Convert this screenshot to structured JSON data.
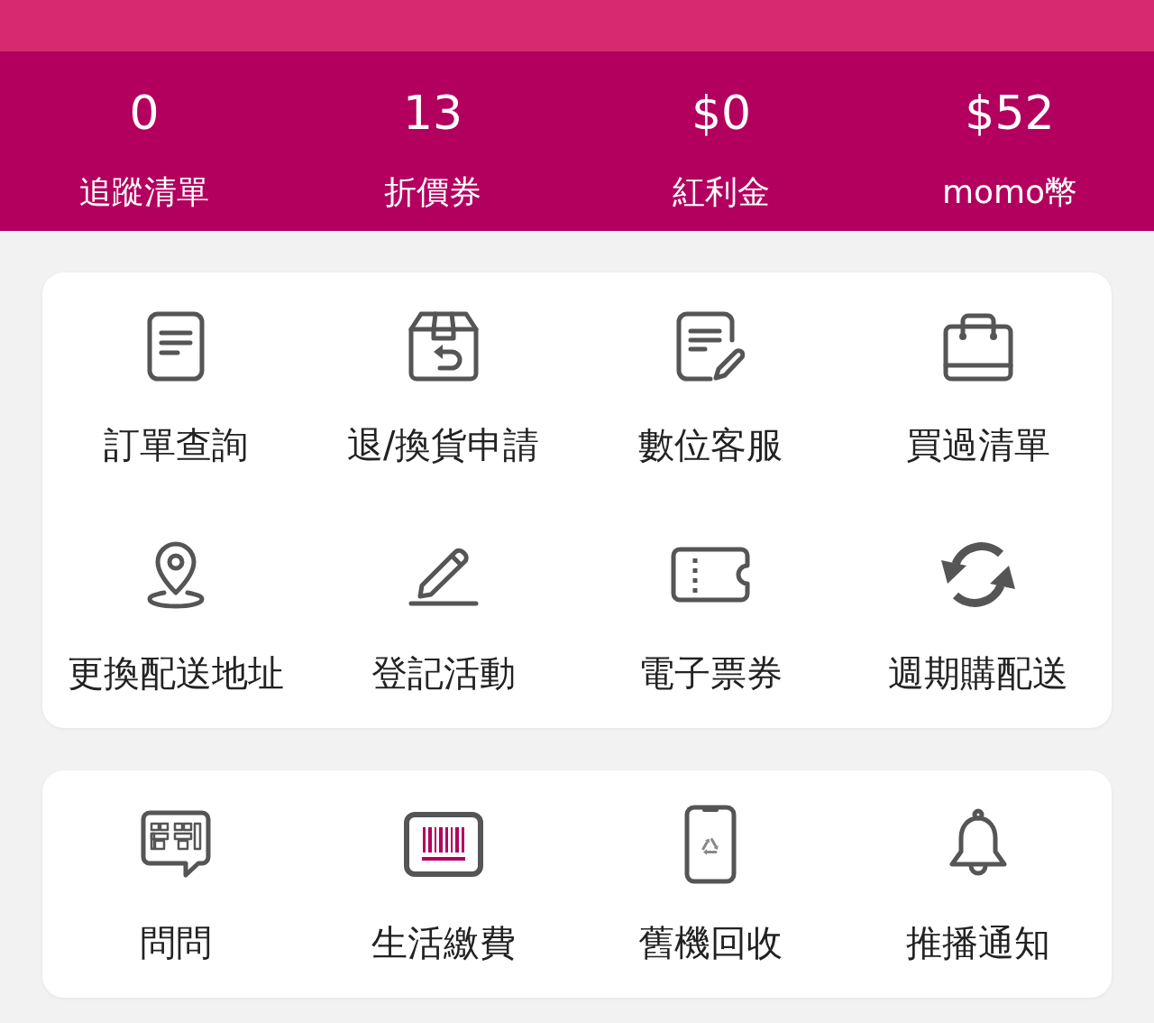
{
  "stats": [
    {
      "value": "0",
      "label": "追蹤清單"
    },
    {
      "value": "13",
      "label": "折價券"
    },
    {
      "value": "$0",
      "label": "紅利金"
    },
    {
      "value": "$52",
      "label": "momo幣"
    }
  ],
  "menu_cards": [
    {
      "items": [
        {
          "label": "訂單查詢"
        },
        {
          "label": "退/換貨申請"
        },
        {
          "label": "數位客服"
        },
        {
          "label": "買過清單"
        },
        {
          "label": "更換配送地址"
        },
        {
          "label": "登記活動"
        },
        {
          "label": "電子票券"
        },
        {
          "label": "週期購配送"
        }
      ]
    },
    {
      "items": [
        {
          "label": "問問"
        },
        {
          "label": "生活繳費"
        },
        {
          "label": "舊機回收"
        },
        {
          "label": "推播通知"
        }
      ]
    }
  ]
}
